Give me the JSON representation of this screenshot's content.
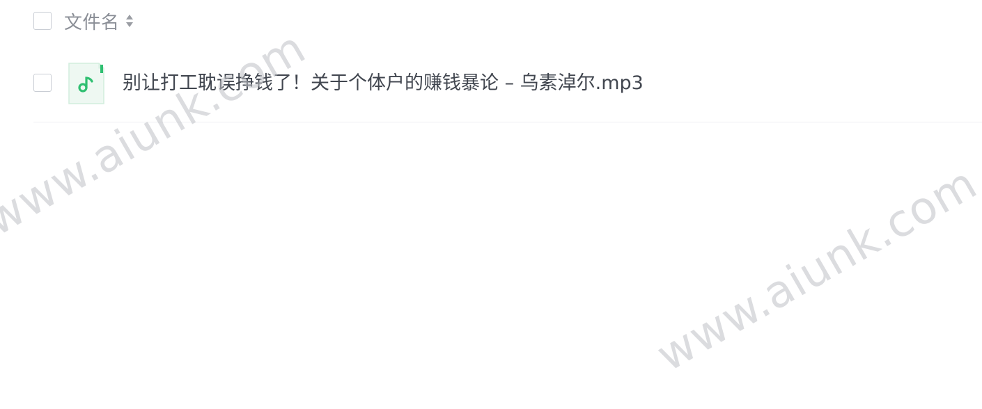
{
  "table": {
    "header": {
      "filename_label": "文件名",
      "sort_icon": "sort-icon"
    },
    "files": [
      {
        "name": "别让打工耽误挣钱了！关于个体户的赚钱暴论 – 乌素淖尔.mp3",
        "icon": "audio-file-icon",
        "icon_color": "#2fbf71"
      }
    ]
  },
  "watermarks": [
    "www.aiunk.com",
    "www.aiunk.com"
  ]
}
